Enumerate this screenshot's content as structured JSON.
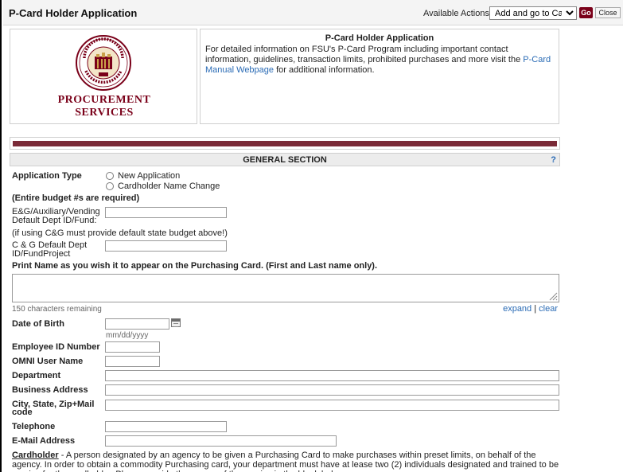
{
  "header": {
    "title": "P-Card Holder Application",
    "actions_label": "Available Actions:",
    "actions_selected": "Add and go to Cart",
    "go_label": "Go",
    "close_label": "Close"
  },
  "logo": {
    "line1": "PROCUREMENT",
    "line2": "SERVICES"
  },
  "info": {
    "title": "P-Card Holder Application",
    "text_before": "For detailed information on FSU's P-Card Program including important contact information, guidelines, transaction limits, prohibited purchases and more visit the ",
    "link_text": "P-Card Manual Webpage",
    "text_after": " for additional information."
  },
  "section": {
    "title": "GENERAL SECTION",
    "help": "?"
  },
  "form": {
    "application_type_label": "Application Type",
    "radio_new": "New Application",
    "radio_change": "Cardholder Name Change",
    "budget_note": "(Entire budget #s are required)",
    "eg_label_1": "E&G/Auxiliary/Vending",
    "eg_label_2": "Default Dept ID/Fund:",
    "cg_note": "(if using C&G must provide default state budget above!)",
    "cg_label_1": "C & G Default Dept",
    "cg_label_2": "ID/FundProject",
    "print_name_label": "Print Name as you wish it to appear on the Purchasing Card. (First and Last name only).",
    "chars_remaining": "150 characters remaining",
    "expand": "expand",
    "separator": "|",
    "clear": "clear",
    "dob_label": "Date of Birth",
    "dob_hint": "mm/dd/yyyy",
    "employee_id_label": "Employee ID Number",
    "omni_label": "OMNI User Name",
    "department_label": "Department",
    "business_address_label": "Business Address",
    "city_label_1": "City, State, Zip+Mail",
    "city_label_2": "code",
    "telephone_label": "Telephone",
    "email_label": "E-Mail Address"
  },
  "cardholder": {
    "term": "Cardholder",
    "text": " - A person designated by an agency to be given a Purchasing Card to make purchases within preset limits, on behalf of the agency. In order to obtain a commodity Purchasing card, your department must have at lease two (2) individuals designated and trained to be proxies for the cardholder. Please provide the names of the proxies in the blank below."
  },
  "colors": {
    "brand": "#7a0019",
    "link": "#2a6bb5"
  }
}
